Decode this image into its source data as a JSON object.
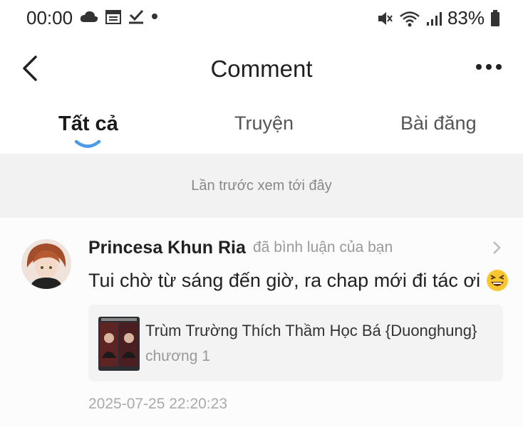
{
  "status_bar": {
    "time": "00:00",
    "battery": "83%"
  },
  "header": {
    "title": "Comment"
  },
  "tabs": [
    {
      "label": "Tất cả",
      "active": true
    },
    {
      "label": "Truyện",
      "active": false
    },
    {
      "label": "Bài đăng",
      "active": false
    }
  ],
  "notice": "Lần trước xem tới đây",
  "comment_item": {
    "username": "Princesa Khun Ria",
    "action": "đã bình luận của bạn",
    "text": "Tui chờ từ sáng đến giờ, ra chap mới đi tác ơi",
    "story_title": "Trùm Trường Thích Thầm Học Bá {Duonghung}",
    "chapter": "chương 1",
    "timestamp": "2025-07-25 22:20:23"
  },
  "colors": {
    "accent": "#4a9be8",
    "notice_bg": "#f2f2f2",
    "card_bg": "#f3f3f3"
  },
  "icons": {
    "status_left": [
      "cloud-icon",
      "calendar-icon",
      "download-check-icon",
      "dot-icon"
    ],
    "status_right": [
      "mute-icon",
      "wifi-icon",
      "signal-icon",
      "battery-icon"
    ],
    "header": [
      "back-arrow-icon",
      "more-dots-icon"
    ],
    "item": [
      "chevron-right-icon",
      "laughing-emoji-icon"
    ]
  }
}
